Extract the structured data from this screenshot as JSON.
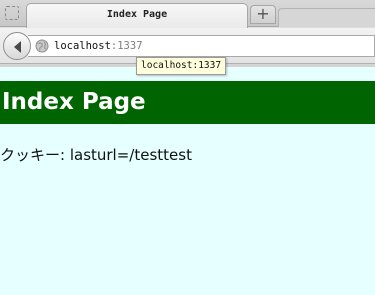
{
  "browser": {
    "tab_title": "Index Page",
    "new_tab_label": "+",
    "url_host": "localhost",
    "url_port": ":1337",
    "tooltip": "localhost:1337"
  },
  "page": {
    "heading": "Index Page",
    "heading_bg": "#006400",
    "body_bg": "#e6ffff",
    "cookie_label": "クッキー: ",
    "cookie_value": "lasturl=/testtest"
  }
}
